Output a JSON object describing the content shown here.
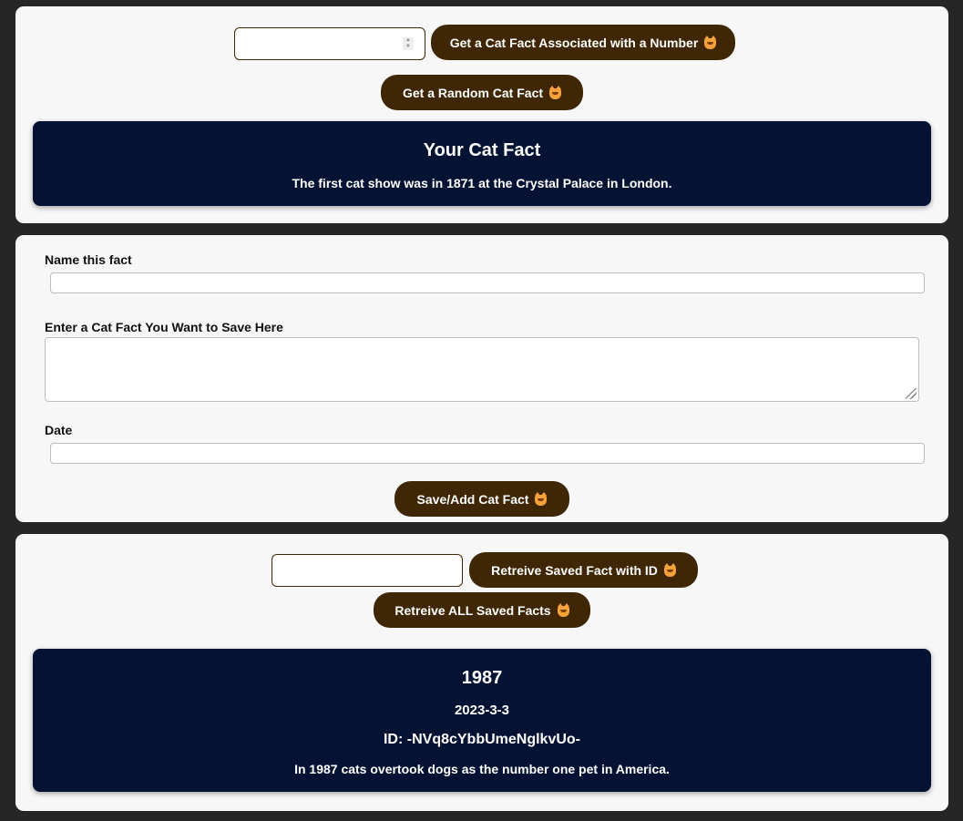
{
  "section_random": {
    "number_input_value": "",
    "number_fact_button": "Get a Cat Fact Associated with a Number",
    "random_fact_button": "Get a Random Cat Fact",
    "fact_panel": {
      "title": "Your Cat Fact",
      "text": "The first cat show was in 1871 at the Crystal Palace in London."
    }
  },
  "section_save": {
    "name_label": "Name this fact",
    "name_value": "",
    "fact_label": "Enter a Cat Fact You Want to Save Here",
    "fact_value": "",
    "date_label": "Date",
    "date_value": "",
    "save_button": "Save/Add Cat Fact"
  },
  "section_retrieve": {
    "id_input_value": "",
    "retrieve_id_button": "Retreive Saved Fact with ID",
    "retrieve_all_button": "Retreive ALL Saved Facts",
    "result": {
      "name": "1987",
      "date": "2023-3-3",
      "id_text": "ID: -NVq8cYbbUmeNglkvUo-",
      "fact": "In 1987 cats overtook dogs as the number one pet in America."
    }
  },
  "icons": {
    "button_emoji": "smiling-cat-face-icon"
  },
  "colors": {
    "background": "#262626",
    "card": "#f7f7f7",
    "button": "#3f2705",
    "panel": "#041233"
  }
}
